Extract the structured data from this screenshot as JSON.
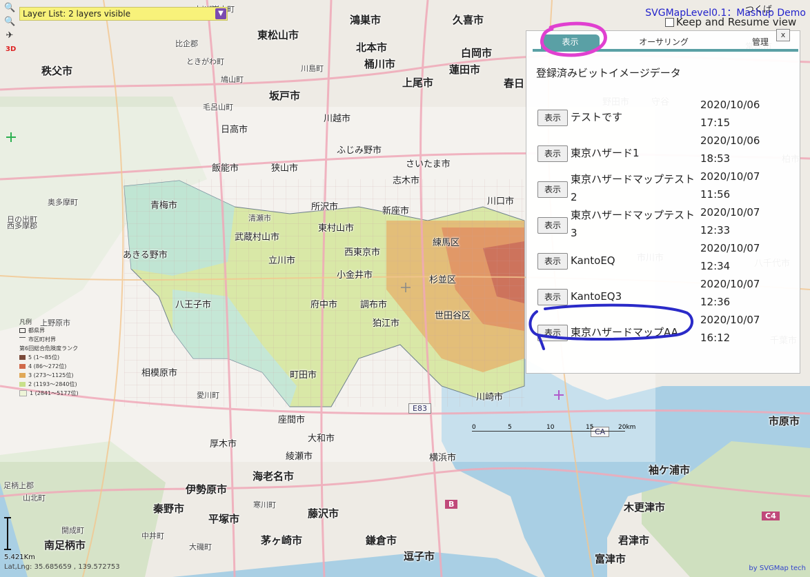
{
  "app": {
    "title": "SVGMapLevel0.1：Mashup Demo",
    "keep_view_label": "Keep and Resume view",
    "layer_list": "Layer List: 2 layers visible"
  },
  "zoom": {
    "zoom_in_icon": "zoom-in-icon",
    "zoom_out_icon": "zoom-out-icon",
    "gps_icon": "gps-icon",
    "badge_3d": "3D"
  },
  "panel": {
    "tabs": [
      "表示",
      "オーサリング",
      "管理"
    ],
    "close_label": "x",
    "heading": "登録済みビットイメージデータ",
    "button_label": "表示",
    "rows": [
      {
        "name": "テストです",
        "date": "2020/10/06",
        "time": "17:15"
      },
      {
        "name": "東京ハザード1",
        "date": "2020/10/06",
        "time": "18:53"
      },
      {
        "name": "東京ハザードマップテスト2",
        "date": "2020/10/07",
        "time": "11:56"
      },
      {
        "name": "東京ハザードマップテスト3",
        "date": "2020/10/07",
        "time": "12:33"
      },
      {
        "name": "KantoEQ",
        "date": "2020/10/07",
        "time": "12:34"
      },
      {
        "name": "KantoEQ3",
        "date": "2020/10/07",
        "time": "12:36"
      },
      {
        "name": "東京ハザードマップAA",
        "date": "2020/10/07",
        "time": "16:12"
      }
    ]
  },
  "status": {
    "scale": "5.421Km",
    "latlng": "Lat,Lng: 35.685659 , 139.572753",
    "credit": "by SVGMap tech"
  },
  "legend": {
    "title": "凡例",
    "items": [
      "都県界",
      "市区町村界",
      "第6回総合危険度ランク",
      "5 (1～85位)",
      "4 (86～272位)",
      "3 (273～1125位)",
      "2 (1193～2840位)",
      "1 (2841～5177位)"
    ]
  },
  "map_scale": {
    "ticks": [
      "0",
      "5",
      "10",
      "15",
      "20km"
    ]
  },
  "road_shields": [
    "E83",
    "CA",
    "B",
    "C4"
  ],
  "colors": {
    "accent_tab": "#5aa0a5",
    "layer_list_bg": "#f8f27a",
    "title_blue": "#2222cc",
    "annotation_pink": "#e040d0",
    "annotation_blue": "#2a2ac8",
    "sea": "#a9cfe4"
  },
  "map_labels": [
    {
      "text": "鴻巣市",
      "cls": "big"
    },
    {
      "text": "久喜市",
      "cls": "big"
    },
    {
      "text": "東松山市",
      "cls": "big"
    },
    {
      "text": "北本市",
      "cls": "big"
    },
    {
      "text": "桶川市",
      "cls": "big"
    },
    {
      "text": "白岡市",
      "cls": "big"
    },
    {
      "text": "蓮田市",
      "cls": "big"
    },
    {
      "text": "秩父市",
      "cls": "big"
    },
    {
      "text": "坂戸市",
      "cls": "big"
    },
    {
      "text": "上尾市",
      "cls": "big"
    },
    {
      "text": "春日",
      "cls": "big"
    },
    {
      "text": "川越市",
      "cls": "mid"
    },
    {
      "text": "日高市",
      "cls": "mid"
    },
    {
      "text": "ふじみ野市",
      "cls": "mid"
    },
    {
      "text": "飯能市",
      "cls": "mid"
    },
    {
      "text": "狭山市",
      "cls": "mid"
    },
    {
      "text": "さいたま市",
      "cls": "mid"
    },
    {
      "text": "志木市",
      "cls": "mid"
    },
    {
      "text": "所沢市",
      "cls": "mid"
    },
    {
      "text": "新座市",
      "cls": "mid"
    },
    {
      "text": "川口市",
      "cls": "mid"
    },
    {
      "text": "青梅市",
      "cls": "mid"
    },
    {
      "text": "東村山市",
      "cls": "mid"
    },
    {
      "text": "練馬区",
      "cls": "mid"
    },
    {
      "text": "武蔵村山市",
      "cls": "mid"
    },
    {
      "text": "西東京市",
      "cls": "mid"
    },
    {
      "text": "あきる野市",
      "cls": "mid"
    },
    {
      "text": "立川市",
      "cls": "mid"
    },
    {
      "text": "小金井市",
      "cls": "mid"
    },
    {
      "text": "杉並区",
      "cls": "mid"
    },
    {
      "text": "八王子市",
      "cls": "mid"
    },
    {
      "text": "府中市",
      "cls": "mid"
    },
    {
      "text": "調布市",
      "cls": "mid"
    },
    {
      "text": "世田谷区",
      "cls": "mid"
    },
    {
      "text": "狛江市",
      "cls": "mid"
    },
    {
      "text": "相模原市",
      "cls": "mid"
    },
    {
      "text": "町田市",
      "cls": "mid"
    },
    {
      "text": "川崎市",
      "cls": "mid"
    },
    {
      "text": "座間市",
      "cls": "mid"
    },
    {
      "text": "大和市",
      "cls": "mid"
    },
    {
      "text": "厚木市",
      "cls": "mid"
    },
    {
      "text": "綾瀬市",
      "cls": "mid"
    },
    {
      "text": "横浜市",
      "cls": "mid"
    },
    {
      "text": "海老名市",
      "cls": "big"
    },
    {
      "text": "伊勢原市",
      "cls": "big"
    },
    {
      "text": "秦野市",
      "cls": "big"
    },
    {
      "text": "平塚市",
      "cls": "big"
    },
    {
      "text": "藤沢市",
      "cls": "big"
    },
    {
      "text": "茅ヶ崎市",
      "cls": "big"
    },
    {
      "text": "鎌倉市",
      "cls": "big"
    },
    {
      "text": "逗子市",
      "cls": "big"
    },
    {
      "text": "南足柄市",
      "cls": "big"
    },
    {
      "text": "袖ケ浦市",
      "cls": "big"
    },
    {
      "text": "木更津市",
      "cls": "big"
    },
    {
      "text": "君津市",
      "cls": "big"
    },
    {
      "text": "富津市",
      "cls": "big"
    },
    {
      "text": "市原市",
      "cls": "big"
    },
    {
      "text": "千葉市",
      "cls": "mid"
    },
    {
      "text": "八千代市",
      "cls": "mid"
    },
    {
      "text": "市川市",
      "cls": "mid"
    },
    {
      "text": "柏市",
      "cls": "mid"
    },
    {
      "text": "野田市",
      "cls": "mid"
    },
    {
      "text": "守谷",
      "cls": "mid"
    },
    {
      "text": "常総市",
      "cls": "mid"
    },
    {
      "text": "つくば",
      "cls": "mid"
    },
    {
      "text": "山北町",
      "cls": "small"
    },
    {
      "text": "開成町",
      "cls": "small"
    },
    {
      "text": "中井町",
      "cls": "small"
    },
    {
      "text": "大磯町",
      "cls": "small"
    },
    {
      "text": "寒川町",
      "cls": "small"
    },
    {
      "text": "愛川町",
      "cls": "small"
    },
    {
      "text": "上野原市",
      "cls": "small"
    },
    {
      "text": "奥多摩町",
      "cls": "small"
    },
    {
      "text": "日の出町",
      "cls": "small"
    },
    {
      "text": "小川町",
      "cls": "small"
    },
    {
      "text": "嵐山町",
      "cls": "small"
    },
    {
      "text": "ときがわ町",
      "cls": "small"
    },
    {
      "text": "鳩山町",
      "cls": "small"
    },
    {
      "text": "毛呂山町",
      "cls": "small"
    },
    {
      "text": "川島町",
      "cls": "small"
    },
    {
      "text": "比企郡",
      "cls": "small"
    },
    {
      "text": "足柄上郡",
      "cls": "small"
    },
    {
      "text": "西多摩郡",
      "cls": "small"
    },
    {
      "text": "清瀬市",
      "cls": "small"
    }
  ]
}
